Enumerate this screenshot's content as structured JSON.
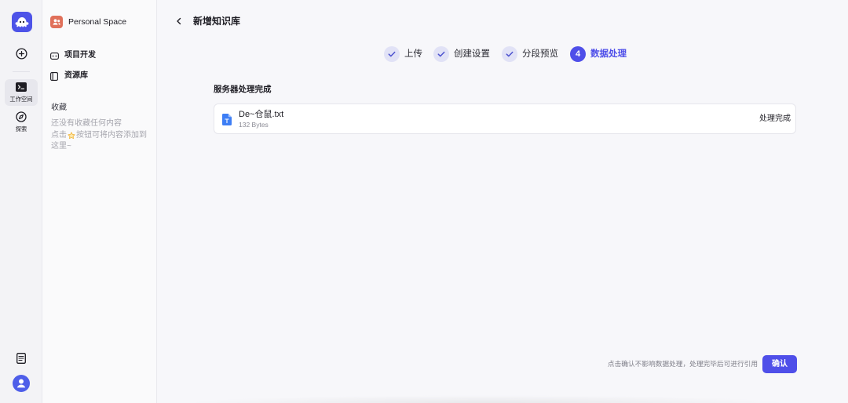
{
  "rail": {
    "logo_icon": "app-mascot-logo-icon",
    "create_icon": "plus-circle-icon",
    "items": [
      {
        "label": "工作空间",
        "icon": "terminal-icon",
        "active": true
      },
      {
        "label": "探索",
        "icon": "compass-icon",
        "active": false
      }
    ],
    "docs_icon": "document-icon",
    "avatar_icon": "user-avatar-icon"
  },
  "sidebar": {
    "space": {
      "name": "Personal Space",
      "icon": "team-icon"
    },
    "nav": [
      {
        "label": "项目开发",
        "icon": "gamepad-icon"
      },
      {
        "label": "资源库",
        "icon": "library-icon"
      }
    ],
    "favorites": {
      "title": "收藏",
      "empty_text": "还没有收藏任何内容",
      "hint_before": "点击",
      "hint_icon": "star-icon",
      "hint_after": "按钮可将内容添加到",
      "hint_end": "这里~"
    }
  },
  "header": {
    "title": "新增知识库",
    "back_icon": "chevron-left-icon"
  },
  "steps": [
    {
      "label": "上传",
      "status": "done"
    },
    {
      "label": "创建设置",
      "status": "done"
    },
    {
      "label": "分段预览",
      "status": "done"
    },
    {
      "label": "数据处理",
      "status": "active",
      "number": "4"
    }
  ],
  "result": {
    "title": "服务器处理完成",
    "files": [
      {
        "name": "De~仓鼠.txt",
        "size": "132 Bytes",
        "status": "处理完成",
        "icon": "txt-file-icon"
      }
    ]
  },
  "footer": {
    "hint": "点击确认不影响数据处理，处理完毕后可进行引用",
    "confirm_label": "确认"
  },
  "colors": {
    "accent": "#4f4fe9",
    "page_bg": "#f7f7fa",
    "step_done_bg": "#e1e2f6",
    "file_icon": "#3d7ef5",
    "space_icon": "#e0705a",
    "avatar": "#4e5ee9",
    "star": "#f2b234"
  }
}
